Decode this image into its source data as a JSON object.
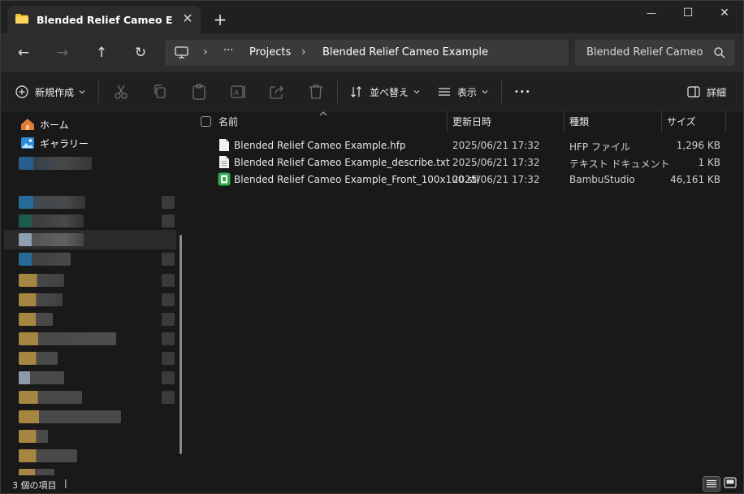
{
  "window": {
    "tab_title": "Blended Relief Cameo Example",
    "close_tab_glyph": "✕",
    "new_tab_glyph": "+",
    "minimize_glyph": "—",
    "maximize_glyph": "☐",
    "close_glyph": "✕"
  },
  "nav": {
    "back_glyph": "←",
    "forward_glyph": "→",
    "up_glyph": "↑",
    "refresh_glyph": "↻",
    "address": {
      "ellipsis": "···",
      "crumb1": "Projects",
      "crumb2": "Blended Relief Cameo Example",
      "sep": "›"
    },
    "search_text": "Blended Relief Cameo"
  },
  "toolbar": {
    "new_label": "新規作成",
    "sort_label": "並べ替え",
    "view_label": "表示",
    "more_glyph": "•••",
    "details_label": "詳細"
  },
  "sidebar": {
    "home_label": "ホーム",
    "gallery_label": "ギャラリー"
  },
  "list": {
    "columns": {
      "name": "名前",
      "date": "更新日時",
      "type": "種類",
      "size": "サイズ"
    },
    "rows": [
      {
        "name": "Blended Relief Cameo Example.hfp",
        "date": "2025/06/21 17:32",
        "type": "HFP ファイル",
        "size": "1,296 KB"
      },
      {
        "name": "Blended Relief Cameo Example_describe.txt",
        "date": "2025/06/21 17:32",
        "type": "テキスト ドキュメント",
        "size": "1 KB"
      },
      {
        "name": "Blended Relief Cameo Example_Front_100x100.stl",
        "date": "2025/06/21 17:32",
        "type": "BambuStudio",
        "size": "46,161 KB"
      }
    ]
  },
  "status": {
    "item_count": "3 個の項目",
    "cursor": "|"
  },
  "colors": {
    "accent": "#0078d4",
    "folder": "#f3c03a",
    "stl_icon": "#2fae4f"
  }
}
